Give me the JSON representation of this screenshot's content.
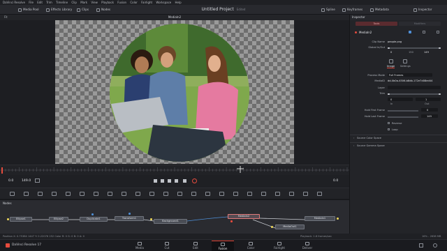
{
  "app": {
    "menu": [
      "DaVinci Resolve",
      "File",
      "Edit",
      "Trim",
      "Timeline",
      "Clip",
      "Mark",
      "View",
      "Playback",
      "Fusion",
      "Color",
      "Fairlight",
      "Workspace",
      "Help"
    ]
  },
  "toolbar": {
    "media_pool": "Media Pool",
    "effects_library": "Effects Library",
    "clips": "Clips",
    "nodes": "Nodes",
    "project_title": "Untitled Project",
    "edited": "Edited",
    "spline": "Spline",
    "keyframes": "Keyframes",
    "metadata": "Metadata",
    "inspector": "Inspector"
  },
  "viewer": {
    "title": "MediaIn2",
    "zoom_label": "Fit",
    "timecode_left": "0.0",
    "timecode_end": "149.0",
    "timecode_right": "0.0"
  },
  "nodes_panel": {
    "title": "Nodes",
    "items": [
      "Ellipse1",
      "Ellipse2",
      "Duplicate1",
      "Transform1",
      "Background1",
      "MediaIn2",
      "MediaOut1",
      "MediaIn1"
    ]
  },
  "inspector": {
    "title": "Inspector",
    "tabs": [
      "Tools",
      "Modifiers"
    ],
    "node_name": "MediaIn2",
    "clip_name_label": "Clip Name",
    "clip_name_value": "people.png",
    "global_inout_label": "Global In/Out",
    "global_in": "0",
    "global_mid": "150",
    "global_out": "149",
    "subtabs": [
      "Image",
      "Settings"
    ],
    "process_mode_label": "Process Mode",
    "process_mode_value": "Full Frames",
    "mediaid_label": "MediaID",
    "mediaid_value": "dd-0b0a-4506-b8db-172e7d08ed44",
    "layer_label": "Layer",
    "trim_label": "Trim",
    "trim_in": "0",
    "trim_out": "1",
    "trim_in_label": "In",
    "trim_out_label": "Out",
    "hold_first_label": "Hold First Frame",
    "hold_first_value": "0",
    "hold_last_label": "Hold Last Frame",
    "hold_last_value": "149",
    "reverse_label": "Reverse",
    "loop_label": "Loop",
    "source_color_space": "Source Color Space",
    "source_gamma_space": "Source Gamma Space"
  },
  "status": {
    "position": "Position  X: 0.75384   1447   Y: 0.22076   252   Color  R: 0    G: 0    B: 0    A: 0",
    "playback": "Playback: 1.8 frames/sec",
    "memory": "16% - 2638 MB"
  },
  "app_name": "DaVinci Resolve 17",
  "pages": [
    "Media",
    "Cut",
    "Edit",
    "Fusion",
    "Color",
    "Fairlight",
    "Deliver"
  ],
  "active_page": "Fusion",
  "colors": {
    "accent": "#e64b3d",
    "panel": "#28292e",
    "selected_node_border": "#e07a7a"
  }
}
